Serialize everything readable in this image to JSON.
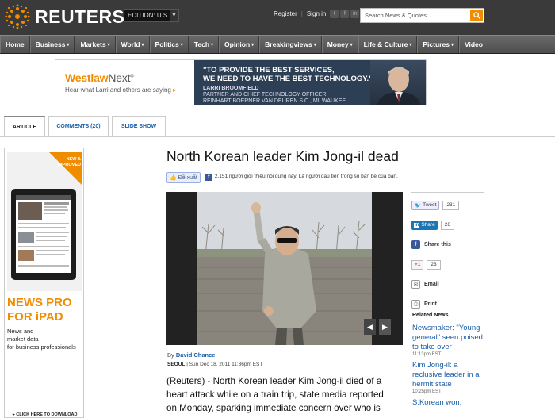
{
  "header": {
    "logo_text": "REUTERS",
    "edition_label": "EDITION: U.S.",
    "register": "Register",
    "sign_in": "Sign in",
    "search_placeholder": "Search News & Quotes"
  },
  "nav": {
    "items": [
      {
        "label": "Home",
        "dropdown": false
      },
      {
        "label": "Business",
        "dropdown": true
      },
      {
        "label": "Markets",
        "dropdown": true
      },
      {
        "label": "World",
        "dropdown": true
      },
      {
        "label": "Politics",
        "dropdown": true
      },
      {
        "label": "Tech",
        "dropdown": true
      },
      {
        "label": "Opinion",
        "dropdown": true
      },
      {
        "label": "Breakingviews",
        "dropdown": true
      },
      {
        "label": "Money",
        "dropdown": true
      },
      {
        "label": "Life & Culture",
        "dropdown": true
      },
      {
        "label": "Pictures",
        "dropdown": true
      },
      {
        "label": "Video",
        "dropdown": false
      }
    ],
    "dropdown_glyph": "▾"
  },
  "ad": {
    "brand": "Westlaw",
    "brand_suffix": "Next",
    "brand_mark": "®",
    "tagline": "Hear what Larri and others are saying",
    "tagline_arrow": "▸",
    "quote_line1": "\"TO PROVIDE THE BEST SERVICES,",
    "quote_line2": "WE NEED TO HAVE THE BEST TECHNOLOGY.\"",
    "person_name": "LARRI BROOMFIELD",
    "person_title": "PARTNER AND CHIEF TECHNOLOGY OFFICER",
    "person_firm": "REINHART BOERNER VAN DEUREN S.C., MILWAUKEE"
  },
  "tabs": [
    {
      "label": "ARTICLE",
      "active": true
    },
    {
      "label": "COMMENTS (20)",
      "active": false
    },
    {
      "label": "SLIDE SHOW",
      "active": false
    }
  ],
  "left_ad": {
    "ribbon": "NEW & IMPROVED",
    "title": "NEWS PRO",
    "subtitle": "FOR iPAD",
    "desc_line1": "News and",
    "desc_line2": "market data",
    "desc_line3": "for business professionals",
    "cta": "CLICK HERE TO DOWNLOAD"
  },
  "article": {
    "headline": "North Korean leader Kim Jong-il dead",
    "fb_like": "Đề xuất",
    "fb_text": "2.151 người giới thiệu nội dung này. Là người đầu tiên trong số bạn bè của bạn.",
    "byline_prefix": "By",
    "author": "David Chance",
    "location": "SEOUL",
    "dateline": "Sun Dec 18, 2011 11:36pm EST",
    "body_line1": "(Reuters) - North Korean leader Kim Jong-il died of a",
    "body_line2": "heart attack while on a train trip, state media reported",
    "body_line3": "on Monday, sparking immediate concern over who is"
  },
  "share": {
    "tweet": "Tweet",
    "tweet_count": "231",
    "linkedin": "Share",
    "linkedin_count": "26",
    "facebook": "Share this",
    "gplus": "+1",
    "gplus_count": "23",
    "email": "Email",
    "print": "Print"
  },
  "related": {
    "title": "Related News",
    "items": [
      {
        "headline": "Newsmaker: \"Young general\" seen poised to take over",
        "time": "11:13pm EST"
      },
      {
        "headline": "Kim Jong-il: a reclusive leader in a hermit state",
        "time": "10:25pm EST"
      },
      {
        "headline": "S.Korean won,",
        "time": ""
      }
    ]
  },
  "colors": {
    "accent_orange": "#f08c00",
    "link_blue": "#1a5ea8",
    "nav_gray": "#5a5a5a",
    "header_dark": "#3a3a3a"
  }
}
